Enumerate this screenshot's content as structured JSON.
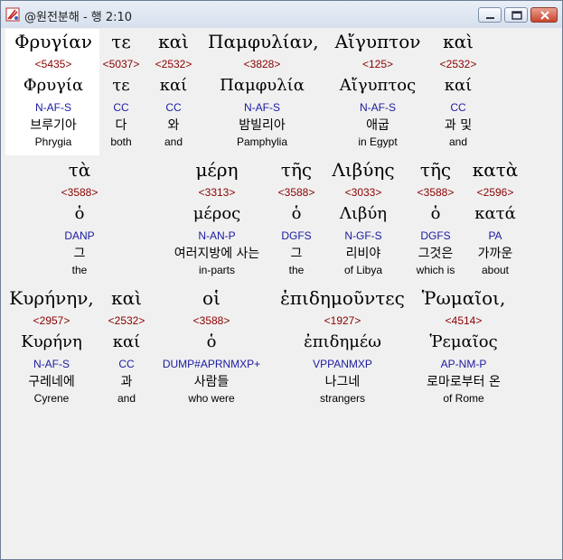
{
  "window": {
    "title": "@원전분해 - 행 2:10",
    "minimize_label": "minimize",
    "maximize_label": "maximize",
    "close_label": "close"
  },
  "rows": [
    {
      "words": [
        {
          "greek": "Φρυγίαν",
          "strong": "<5435>",
          "lemma": "Φρυγία",
          "morph": "N-AF-S",
          "korean": "브루기아",
          "english": "Phrygia",
          "selected": true
        },
        {
          "greek": "τε",
          "strong": "<5037>",
          "lemma": "τε",
          "morph": "CC",
          "korean": "다",
          "english": "both"
        },
        {
          "greek": "καὶ",
          "strong": "<2532>",
          "lemma": "καί",
          "morph": "CC",
          "korean": "와",
          "english": "and"
        },
        {
          "greek": "Παμφυλίαν,",
          "strong": "<3828>",
          "lemma": "Παμφυλία",
          "morph": "N-AF-S",
          "korean": "밤빌리아",
          "english": "Pamphylia"
        },
        {
          "greek": "Αἴγυπτον",
          "strong": "<125>",
          "lemma": "Αἴγυπτος",
          "morph": "N-AF-S",
          "korean": "애굽",
          "english": "in Egypt"
        },
        {
          "greek": "καὶ",
          "strong": "<2532>",
          "lemma": "καί",
          "morph": "CC",
          "korean": "과 및",
          "english": "and"
        }
      ]
    },
    {
      "words": [
        {
          "greek": "τὰ",
          "strong": "<3588>",
          "lemma": "ὁ",
          "morph": "DANP",
          "korean": "그",
          "english": "the"
        },
        {
          "greek": "μέρη",
          "strong": "<3313>",
          "lemma": "μέρος",
          "morph": "N-AN-P",
          "korean": "여러지방에 사는",
          "english": "in-parts"
        },
        {
          "greek": "τῆς",
          "strong": "<3588>",
          "lemma": "ὁ",
          "morph": "DGFS",
          "korean": "그",
          "english": "the"
        },
        {
          "greek": "Λιβύης",
          "strong": "<3033>",
          "lemma": "Λιβύη",
          "morph": "N-GF-S",
          "korean": "리비야",
          "english": "of Libya"
        },
        {
          "greek": "τῆς",
          "strong": "<3588>",
          "lemma": "ὁ",
          "morph": "DGFS",
          "korean": "그것은",
          "english": "which is"
        },
        {
          "greek": "κατὰ",
          "strong": "<2596>",
          "lemma": "κατά",
          "morph": "PA",
          "korean": "가까운",
          "english": "about"
        }
      ]
    },
    {
      "words": [
        {
          "greek": "Κυρήνην,",
          "strong": "<2957>",
          "lemma": "Κυρήνη",
          "morph": "N-AF-S",
          "korean": "구레네에",
          "english": "Cyrene"
        },
        {
          "greek": "καὶ",
          "strong": "<2532>",
          "lemma": "καί",
          "morph": "CC",
          "korean": "과",
          "english": "and"
        },
        {
          "greek": "οἱ",
          "strong": "<3588>",
          "lemma": "ὁ",
          "morph": "DUMP#APRNMXP+",
          "korean": "사람들",
          "english": "who were"
        },
        {
          "greek": "ἐπιδημοῦντες",
          "strong": "<1927>",
          "lemma": "ἐπιδημέω",
          "morph": "VPPANMXP",
          "korean": "나그네",
          "english": "strangers"
        },
        {
          "greek": "Ῥωμαῖοι,",
          "strong": "<4514>",
          "lemma": "Ῥεμαῖος",
          "morph": "AP-NM-P",
          "korean": "로마로부터 온",
          "english": "of Rome"
        }
      ]
    }
  ]
}
